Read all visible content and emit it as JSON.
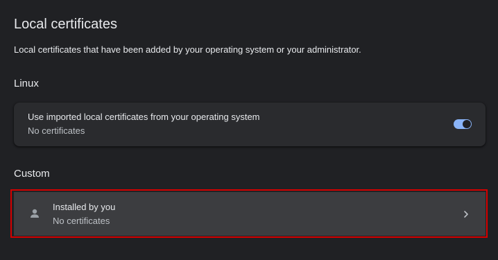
{
  "page": {
    "title": "Local certificates",
    "description": "Local certificates that have been added by your operating system or your administrator."
  },
  "linux_section": {
    "heading": "Linux",
    "row": {
      "title": "Use imported local certificates from your operating system",
      "subtitle": "No certificates",
      "toggle_on": true
    }
  },
  "custom_section": {
    "heading": "Custom",
    "row": {
      "icon": "person-icon",
      "title": "Installed by you",
      "subtitle": "No certificates",
      "trailing_icon": "chevron-right-icon",
      "highlighted": true
    }
  },
  "colors": {
    "background": "#202124",
    "card": "#2a2b2e",
    "card_highlighted": "#3c3d40",
    "toggle_accent": "#8ab4f8",
    "highlight_frame": "#d50000",
    "primary_text": "#e8eaed",
    "secondary_text": "#bdc1c6"
  }
}
